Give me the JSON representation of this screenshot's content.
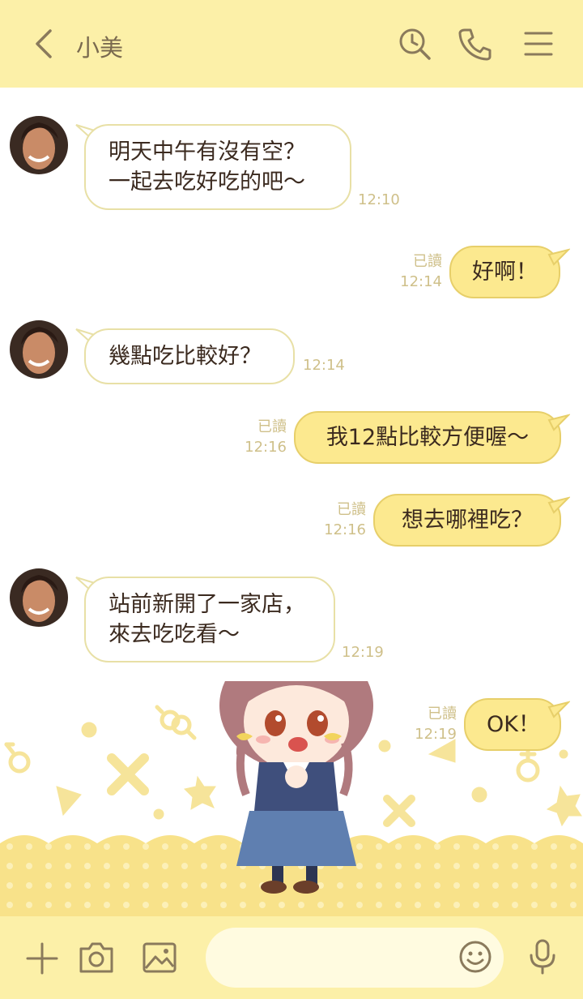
{
  "header": {
    "contact_name": "小美"
  },
  "messages": [
    {
      "direction": "in",
      "lines": [
        "明天中午有沒有空？",
        "一起去吃好吃的吧～"
      ],
      "time": "12:10"
    },
    {
      "direction": "out",
      "text": "好啊！",
      "read": "已讀",
      "time": "12:14"
    },
    {
      "direction": "in",
      "lines": [
        "幾點吃比較好？"
      ],
      "time": "12:14"
    },
    {
      "direction": "out",
      "text": "我12點比較方便喔～",
      "read": "已讀",
      "time": "12:16"
    },
    {
      "direction": "out",
      "text": "想去哪裡吃？",
      "read": "已讀",
      "time": "12:16"
    },
    {
      "direction": "in",
      "lines": [
        "站前新開了一家店，",
        "來去吃吃看～"
      ],
      "time": "12:19"
    },
    {
      "direction": "out",
      "text": "OK！",
      "read": "已讀",
      "time": "12:19"
    }
  ],
  "footer": {
    "input_placeholder": ""
  },
  "colors": {
    "header_bg": "#fcf0a8",
    "bubble_out": "#fce98f",
    "accent_text": "#7a6a4f"
  }
}
